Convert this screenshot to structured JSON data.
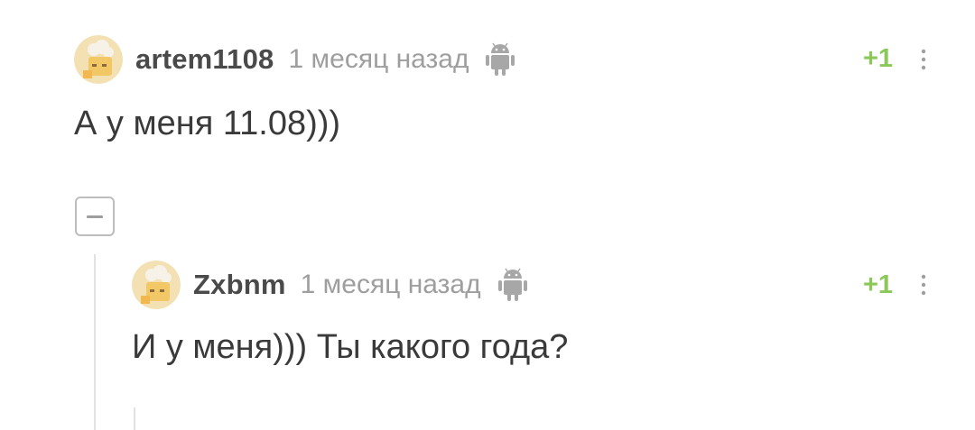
{
  "comments": [
    {
      "author": "artem1108",
      "time": "1 месяц назад",
      "platform_icon": "android-icon",
      "rating": "+1",
      "text": "А у меня 11.08)))"
    },
    {
      "author": "Zxbnm",
      "time": "1 месяц назад",
      "platform_icon": "android-icon",
      "rating": "+1",
      "text": "И у меня))) Ты какого года?"
    }
  ],
  "collapse_icon": "minus-icon",
  "more_icon": "vertical-dots-icon",
  "colors": {
    "rating_green": "#8ac858",
    "meta_gray": "#9e9e9e",
    "text_dark": "#3a3a3a"
  }
}
